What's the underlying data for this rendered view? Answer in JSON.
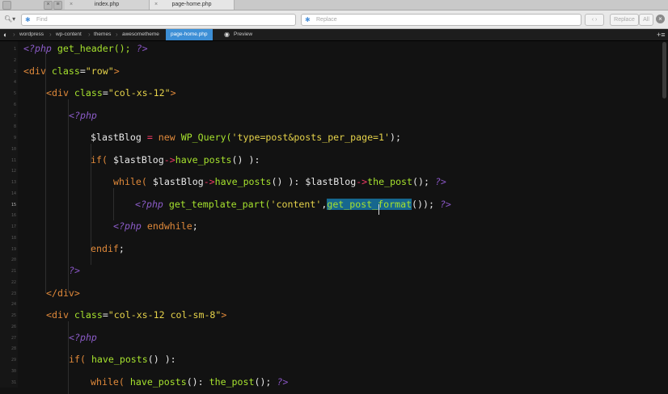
{
  "tabs": [
    {
      "label": "index.php"
    },
    {
      "label": "page-home.php"
    }
  ],
  "find": {
    "placeholder": "Find"
  },
  "replace": {
    "placeholder": "Replace",
    "replace_label": "Replace",
    "all_label": "All"
  },
  "breadcrumb": {
    "items": [
      "wordpress",
      "wp-content",
      "themes",
      "awesometheme",
      "page-home.php"
    ],
    "preview_label": "Preview"
  },
  "line_numbers": [
    "1",
    "2",
    "3",
    "4",
    "5",
    "6",
    "7",
    "8",
    "9",
    "10",
    "11",
    "12",
    "13",
    "14",
    "15",
    "16",
    "17",
    "18",
    "19",
    "20",
    "21",
    "22",
    "23",
    "24",
    "25",
    "26",
    "27",
    "28",
    "29",
    "30",
    "31"
  ],
  "code": {
    "l1": {
      "a": "<?php",
      "b": "get_header();",
      "c": "?>"
    },
    "l3": {
      "a": "<div",
      "b": "class",
      "c": "=",
      "d": "\"row\"",
      "e": ">"
    },
    "l5": {
      "a": "<div",
      "b": "class",
      "c": "=",
      "d": "\"col-xs-12\"",
      "e": ">"
    },
    "l7": {
      "a": "<?php"
    },
    "l9": {
      "a": "$lastBlog",
      "b": "=",
      "c": "new",
      "d": "WP_Query(",
      "e": "'type=post&posts_per_page=1'",
      "f": ");"
    },
    "l11": {
      "a": "if(",
      "b": "$lastBlog",
      "c": "->",
      "d": "have_posts",
      "e": "() ):"
    },
    "l13": {
      "a": "while(",
      "b": "$lastBlog",
      "c": "->",
      "d": "have_posts",
      "e": "() ):",
      "f": "$lastBlog",
      "g": "->",
      "h": "the_post",
      "i": "();",
      "j": "?>"
    },
    "l15": {
      "a": "<?php",
      "b": "get_template_part(",
      "c": "'content'",
      "d": ",",
      "e": "get_post_format",
      "f": "());",
      "g": "?>"
    },
    "l17": {
      "a": "<?php",
      "b": "endwhile",
      "c": ";"
    },
    "l19": {
      "a": "endif",
      "b": ";"
    },
    "l21": {
      "a": "?>"
    },
    "l23": {
      "a": "</div>"
    },
    "l25": {
      "a": "<div",
      "b": "class",
      "c": "=",
      "d": "\"col-xs-12 col-sm-8\"",
      "e": ">"
    },
    "l27": {
      "a": "<?php"
    },
    "l29": {
      "a": "if(",
      "b": "have_posts",
      "c": "() ):"
    },
    "l31": {
      "a": "while(",
      "b": "have_posts",
      "c": "():",
      "d": "the_post",
      "e": "();",
      "f": "?>"
    }
  },
  "colors": {
    "keyword": "#e0893a",
    "function": "#a6e22e",
    "string": "#e5d24a",
    "operator": "#f23b66",
    "php_tag": "#8c5cc9",
    "selection": "#16678f",
    "active_crumb": "#3d8fd6"
  }
}
